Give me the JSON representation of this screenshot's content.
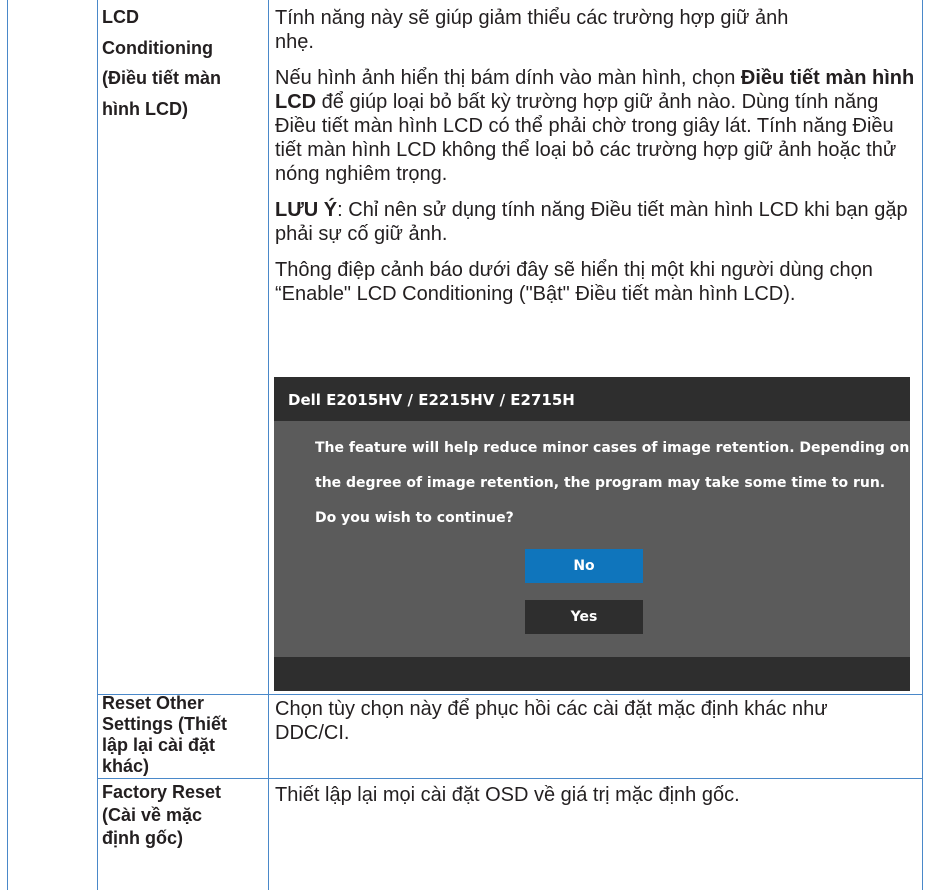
{
  "rows": [
    {
      "label": [
        "LCD",
        "Conditioning",
        "(Điều tiết màn",
        "hình LCD)"
      ],
      "paragraphs": [
        {
          "lines": [
            "Tính năng này sẽ giúp giảm thiểu các trường hợp giữ ảnh",
            "nhẹ."
          ]
        },
        {
          "pre": "Nếu hình ảnh hiển thị bám dính vào màn hình, chọn ",
          "bold": "Điều tiết màn hình LCD",
          "post": " để giúp loại bỏ bất kỳ trường hợp giữ ảnh nào. Dùng tính năng Điều tiết màn hình LCD có thể phải chờ trong giây lát. Tính năng Điều tiết màn hình LCD không thể loại bỏ các trường hợp giữ ảnh hoặc thử nóng nghiêm trọng."
        },
        {
          "bold": "LƯU Ý",
          "post": ": Chỉ nên sử dụng tính năng Điều tiết màn hình LCD khi bạn gặp phải sự cố giữ ảnh."
        },
        {
          "text": "Thông điệp cảnh báo dưới đây sẽ hiển thị một khi người dùng chọn “Enable\" LCD Conditioning (\"Bật\" Điều tiết màn hình LCD)."
        }
      ]
    },
    {
      "label": [
        "Reset Other",
        "Settings (Thiết",
        "lập lại cài đặt",
        "khác)"
      ],
      "text": "Chọn tùy chọn này để phục hồi các cài đặt mặc định khác như DDC/CI."
    },
    {
      "label": [
        "Factory Reset",
        "(Cài về mặc",
        "định gốc)"
      ],
      "text": "Thiết lập lại mọi cài đặt OSD về giá trị mặc định gốc."
    }
  ],
  "dialog": {
    "title": "Dell E2015HV / E2215HV / E2715H",
    "messages": [
      "The feature will help reduce minor cases of image retention. Depending on",
      "the degree of image retention, the program may take some time to run.",
      "Do you wish to continue?"
    ],
    "no_label": "No",
    "yes_label": "Yes"
  }
}
